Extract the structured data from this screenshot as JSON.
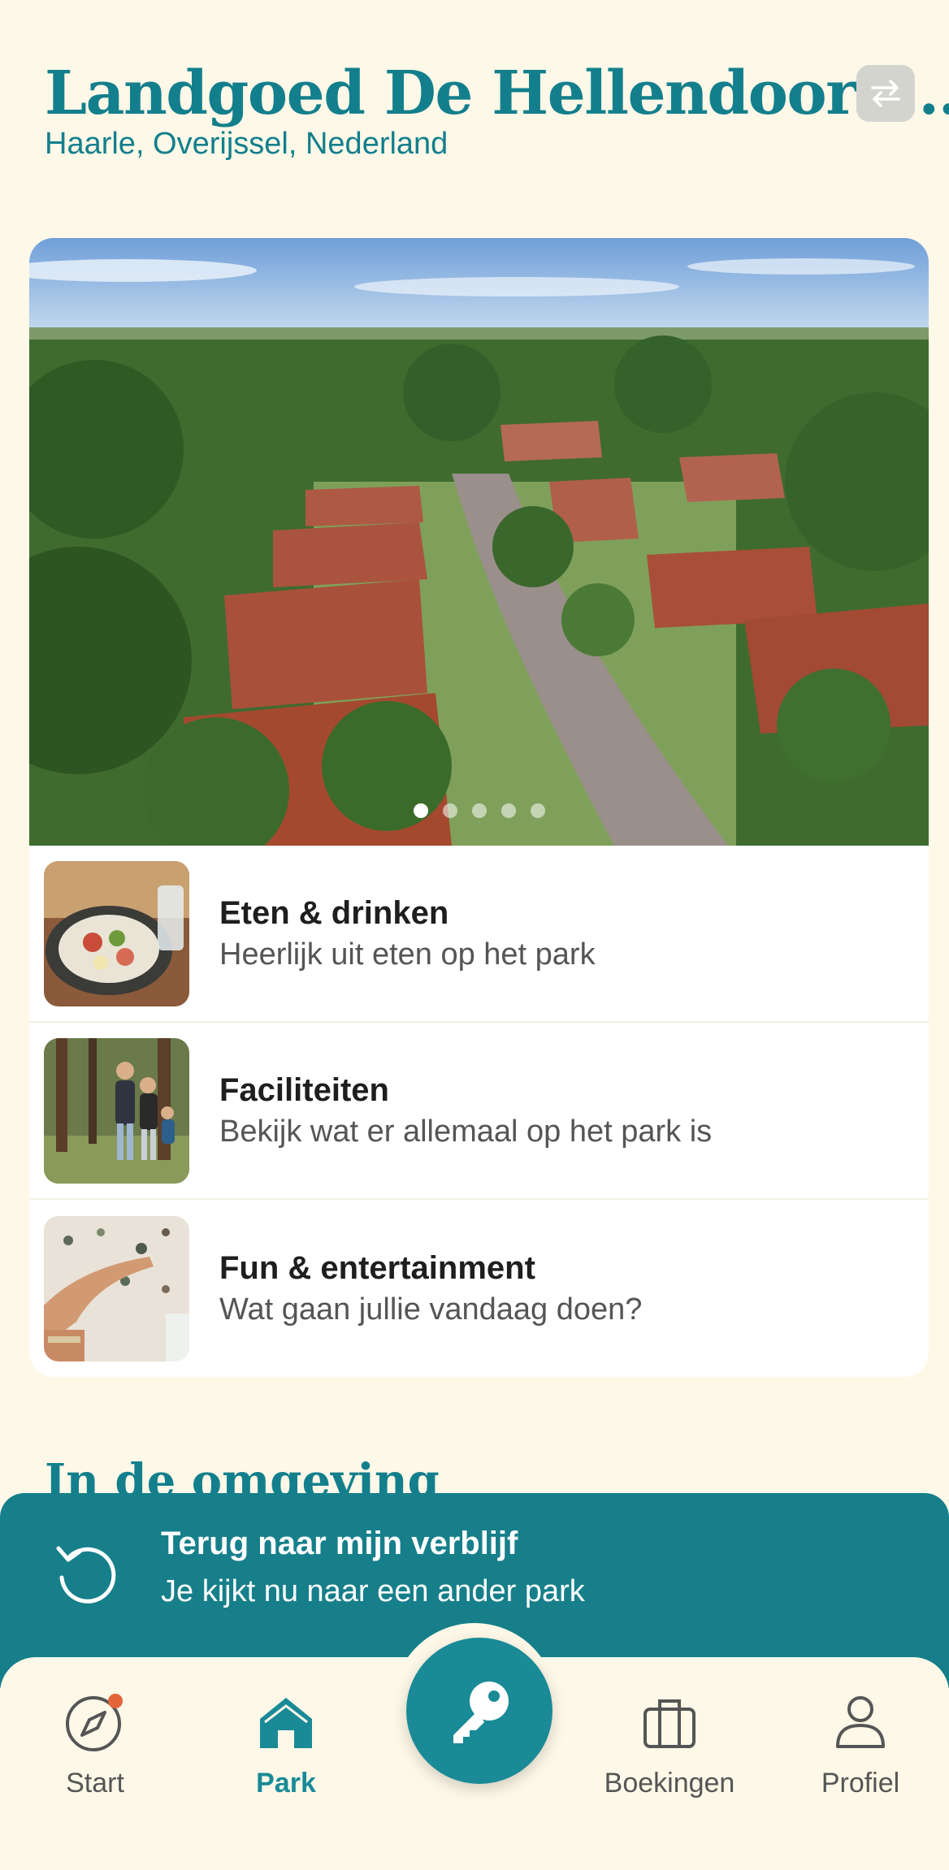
{
  "header": {
    "title": "Landgoed De Hellendoorn...",
    "subtitle": "Haarle, Overijssel, Nederland"
  },
  "carousel": {
    "slide_count": 5,
    "active_index": 0
  },
  "list": [
    {
      "title": "Eten & drinken",
      "subtitle": "Heerlijk uit eten op het park",
      "icon": "food-photo"
    },
    {
      "title": "Faciliteiten",
      "subtitle": "Bekijk wat er allemaal op het park is",
      "icon": "family-walk-photo"
    },
    {
      "title": "Fun & entertainment",
      "subtitle": "Wat gaan jullie vandaag doen?",
      "icon": "activity-photo"
    }
  ],
  "section_title": "In de omgeving",
  "banner": {
    "title": "Terug naar mijn verblijf",
    "subtitle": "Je kijkt nu naar een ander park"
  },
  "tabs": [
    {
      "label": "Start",
      "icon": "compass-icon",
      "active": false,
      "badge": true
    },
    {
      "label": "Park",
      "icon": "home-icon",
      "active": true
    },
    {
      "label": "Boekingen",
      "icon": "briefcase-icon",
      "active": false
    },
    {
      "label": "Profiel",
      "icon": "user-icon",
      "active": false
    }
  ],
  "colors": {
    "primary": "#137f8c",
    "background": "#fdf8e8",
    "banner": "#167f8a",
    "badge": "#e4643a"
  }
}
